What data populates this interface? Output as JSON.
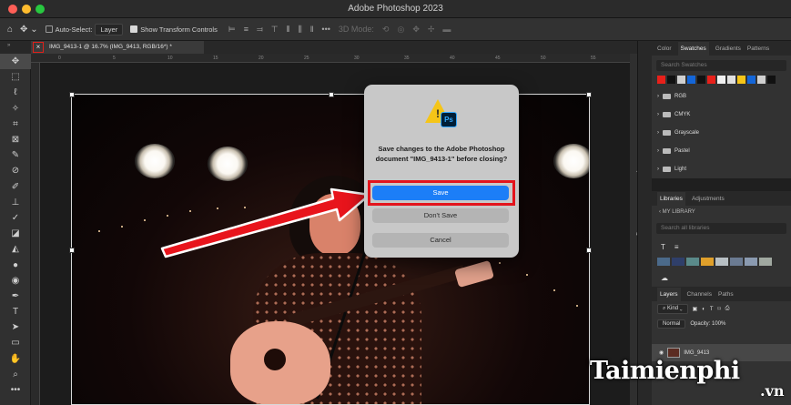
{
  "window": {
    "title": "Adobe Photoshop 2023"
  },
  "options_bar": {
    "auto_select_label": "Auto-Select:",
    "auto_select_target": "Layer",
    "show_transform_label": "Show Transform Controls",
    "mode_3d_label": "3D Mode:"
  },
  "document_tab": {
    "close_glyph": "×",
    "title": "IMG_9413-1 @ 16.7% (IMG_9413, RGB/16*) *"
  },
  "ruler": {
    "ticks": [
      "0",
      "5",
      "10",
      "15",
      "20",
      "25",
      "30",
      "35",
      "40",
      "45",
      "50",
      "55"
    ]
  },
  "dialog": {
    "message": "Save changes to the Adobe Photoshop document \"IMG_9413-1\" before closing?",
    "save_label": "Save",
    "dont_save_label": "Don't Save",
    "cancel_label": "Cancel",
    "badge": "Ps",
    "warning_glyph": "!"
  },
  "right_panel": {
    "top_tabs": [
      "Color",
      "Swatches",
      "Gradients",
      "Patterns"
    ],
    "active_top_tab": "Swatches",
    "search_placeholder": "Search Swatches",
    "swatch_colors": [
      "#e8201a",
      "#111111",
      "#d0d0d0",
      "#1466d8",
      "#111111",
      "#e8201a",
      "#f0f0f0",
      "#e0e0e0",
      "#f5c518",
      "#1466d8",
      "#d0d0d0",
      "#111111"
    ],
    "swatch_groups": [
      "RGB",
      "CMYK",
      "Grayscale",
      "Pastel",
      "Light"
    ],
    "lib_tabs": [
      "Libraries",
      "Adjustments"
    ],
    "library_nav": "MY LIBRARY",
    "library_search": "Search all libraries",
    "library_colors": [
      "#4b6a8a",
      "#2f3f6a",
      "#5a8a8a",
      "#e0a02b",
      "#b8c0c4",
      "#6b7b92",
      "#8a9ab0",
      "#a0a8a0"
    ],
    "layer_tabs": [
      "Layers",
      "Channels",
      "Paths"
    ],
    "kind_label": "Kind",
    "blend_mode": "Normal",
    "opacity_label": "Opacity: 100%",
    "layer_name": "IMG_9413"
  },
  "watermark": {
    "text": "Taimienphi",
    "suffix": ".vn"
  }
}
